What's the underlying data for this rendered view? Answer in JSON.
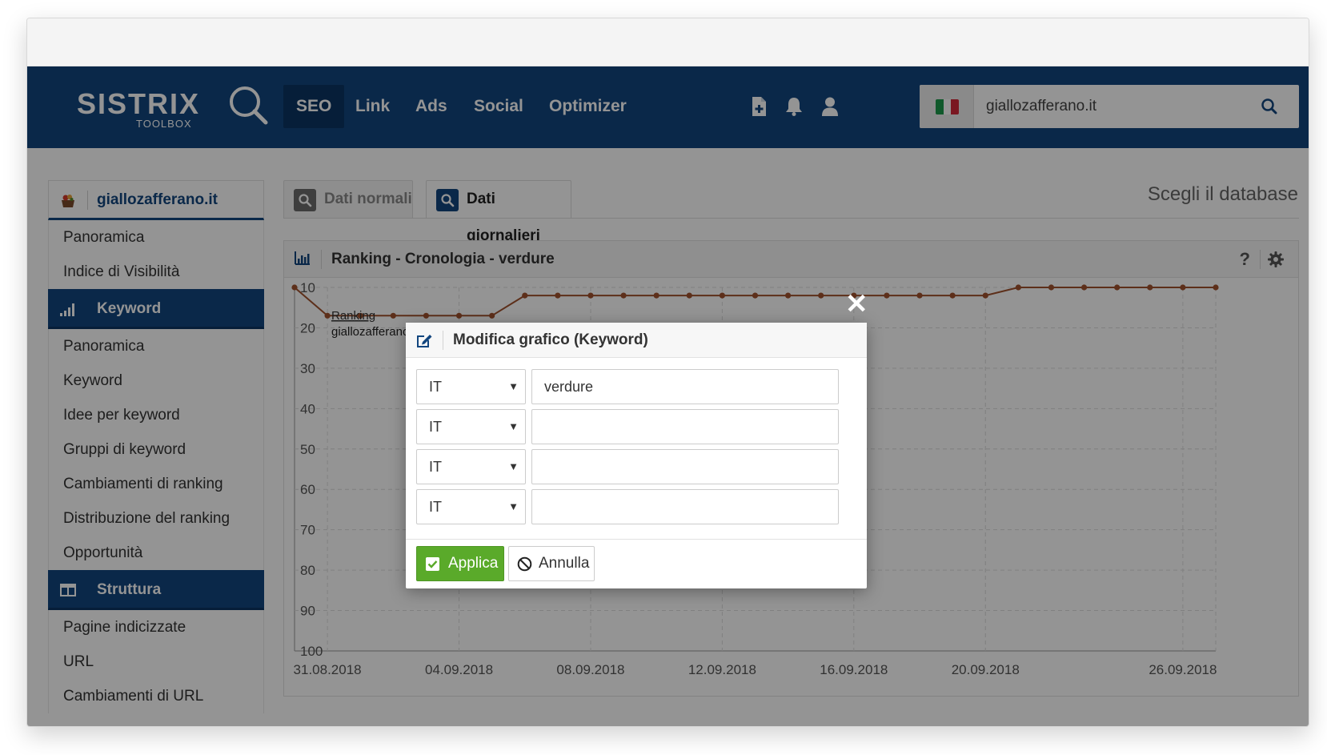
{
  "topnav": {
    "logo_text": "SISTRIX",
    "logo_sub": "TOOLBOX",
    "items": [
      {
        "label": "SEO",
        "active": true
      },
      {
        "label": "Link",
        "active": false
      },
      {
        "label": "Ads",
        "active": false
      },
      {
        "label": "Social",
        "active": false
      },
      {
        "label": "Optimizer",
        "active": false
      }
    ],
    "icons": [
      "add-document-icon",
      "bell-icon",
      "user-icon"
    ],
    "search": {
      "country_flag": "italy-flag-icon",
      "value": "giallozafferano.it",
      "icon": "search-icon"
    }
  },
  "sidebar": {
    "domain_section": {
      "label": "giallozafferano.it",
      "icon": "site-favicon-icon"
    },
    "domain_items": [
      "Panoramica",
      "Indice di Visibilità"
    ],
    "keyword_section": {
      "label": "Keyword",
      "icon": "bar-chart-icon"
    },
    "keyword_items": [
      "Panoramica",
      "Keyword",
      "Idee per keyword",
      "Gruppi di keyword",
      "Cambiamenti di ranking",
      "Distribuzione del ranking",
      "Opportunità"
    ],
    "structure_section": {
      "label": "Struttura",
      "icon": "columns-icon"
    },
    "structure_items": [
      "Pagine indicizzate",
      "URL",
      "Cambiamenti di URL"
    ]
  },
  "tabs": [
    {
      "label": "Dati normali",
      "active": false
    },
    {
      "label": "Dati giornalieri",
      "active": true
    }
  ],
  "db_label": "Scegli il database",
  "panel": {
    "title": "Ranking - Cronologia - verdure",
    "help": "?",
    "legend_label": "Ranking",
    "legend_domain": "giallozafferano.it"
  },
  "chart_data": {
    "type": "line",
    "title": "Ranking - Cronologia - verdure",
    "series": [
      {
        "name": "giallozafferano.it",
        "values": [
          10,
          17,
          17,
          17,
          17,
          17,
          17,
          12,
          12,
          12,
          12,
          12,
          12,
          12,
          12,
          12,
          12,
          12,
          12,
          12,
          12,
          12,
          10,
          10,
          10,
          10,
          10,
          10,
          10
        ]
      }
    ],
    "x": [
      "30.08.2018",
      "31.08.2018",
      "01.09.2018",
      "02.09.2018",
      "03.09.2018",
      "04.09.2018",
      "05.09.2018",
      "06.09.2018",
      "07.09.2018",
      "08.09.2018",
      "09.09.2018",
      "10.09.2018",
      "11.09.2018",
      "12.09.2018",
      "13.09.2018",
      "14.09.2018",
      "15.09.2018",
      "16.09.2018",
      "17.09.2018",
      "18.09.2018",
      "19.09.2018",
      "20.09.2018",
      "21.09.2018",
      "22.09.2018",
      "23.09.2018",
      "24.09.2018",
      "25.09.2018",
      "26.09.2018",
      "27.09.2018"
    ],
    "x_tick_labels": [
      "31.08.2018",
      "04.09.2018",
      "08.09.2018",
      "12.09.2018",
      "16.09.2018",
      "20.09.2018",
      "26.09.2018"
    ],
    "y_tick_labels": [
      "10",
      "20",
      "30",
      "40",
      "50",
      "60",
      "70",
      "80",
      "90",
      "100"
    ],
    "ylim": [
      100,
      10
    ],
    "y_inverted": true,
    "grid": true,
    "color": "#a0522d"
  },
  "modal": {
    "title": "Modifica grafico (Keyword)",
    "close_icon": "close-icon",
    "rows": [
      {
        "country": "IT",
        "keyword": "verdure"
      },
      {
        "country": "IT",
        "keyword": ""
      },
      {
        "country": "IT",
        "keyword": ""
      },
      {
        "country": "IT",
        "keyword": ""
      }
    ],
    "apply_label": "Applica",
    "cancel_label": "Annulla"
  },
  "colors": {
    "brand": "#12467f",
    "apply": "#5aaa2a",
    "series": "#a0522d"
  }
}
